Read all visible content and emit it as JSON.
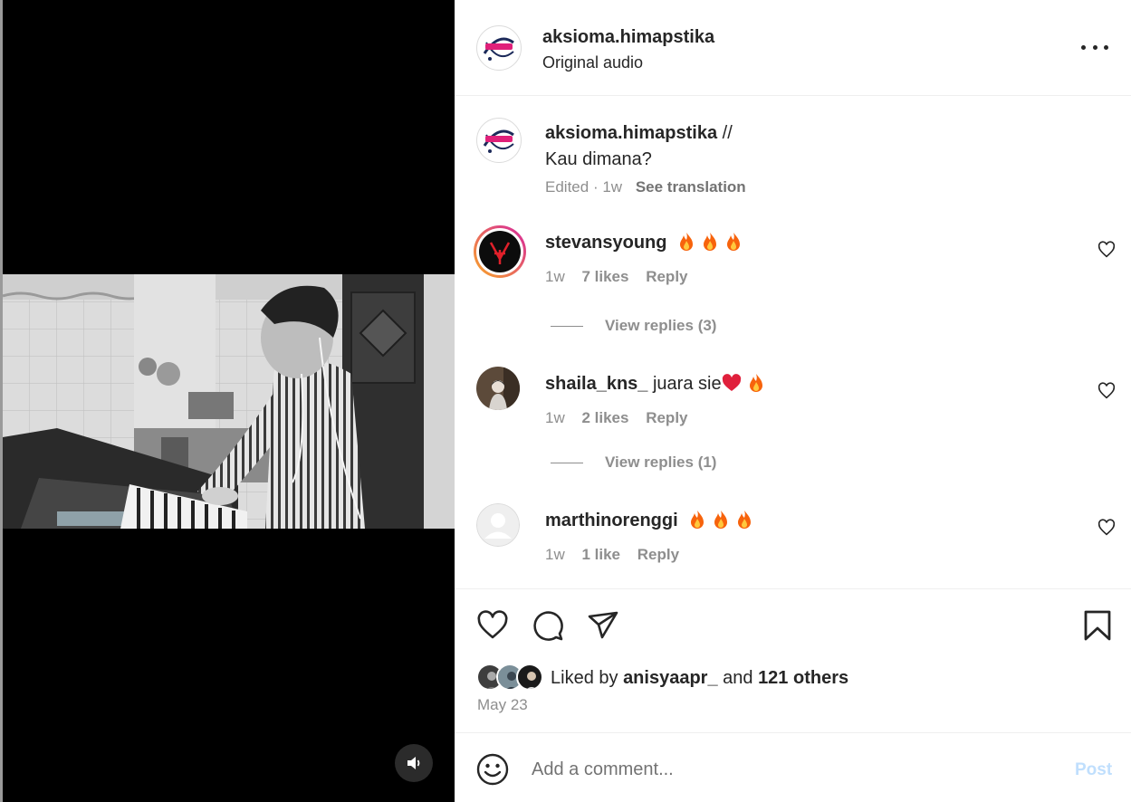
{
  "post": {
    "username": "aksioma.himapstika",
    "audio": "Original audio"
  },
  "caption": {
    "username": "aksioma.himapstika",
    "text_line1": " //",
    "text_line2": "Kau dimana?",
    "edited": "Edited",
    "separator": "·",
    "age": "1w",
    "see_translation": "See translation"
  },
  "comments": [
    {
      "username": "stevansyoung",
      "text": "",
      "emoji": [
        "fire",
        "fire",
        "fire"
      ],
      "age": "1w",
      "likes": "7 likes",
      "reply": "Reply",
      "view_replies": "View replies (3)"
    },
    {
      "username": "shaila_kns_",
      "text": "juara sie",
      "emoji": [
        "red-heart",
        "fire"
      ],
      "age": "1w",
      "likes": "2 likes",
      "reply": "Reply",
      "view_replies": "View replies (1)"
    },
    {
      "username": "marthinorenggi",
      "text": "",
      "emoji": [
        "fire",
        "fire",
        "fire"
      ],
      "age": "1w",
      "likes": "1 like",
      "reply": "Reply"
    }
  ],
  "likes": {
    "prefix": "Liked by ",
    "user": "anisyaapr_",
    "middle": " and ",
    "others": "121 others"
  },
  "date": "May 23",
  "composer": {
    "placeholder": "Add a comment...",
    "post_label": "Post"
  },
  "colors": {
    "fire": "#f7630c",
    "red_heart": "#e0203c",
    "post_button_disabled": "#c0dffd",
    "story_ring_start": "#f9a825",
    "story_ring_end": "#d6249f"
  },
  "icons": [
    "volume-icon",
    "more-options-icon",
    "heart-icon",
    "comment-icon",
    "share-icon",
    "bookmark-icon",
    "emoji-icon",
    "fire-emoji",
    "red-heart-emoji"
  ]
}
